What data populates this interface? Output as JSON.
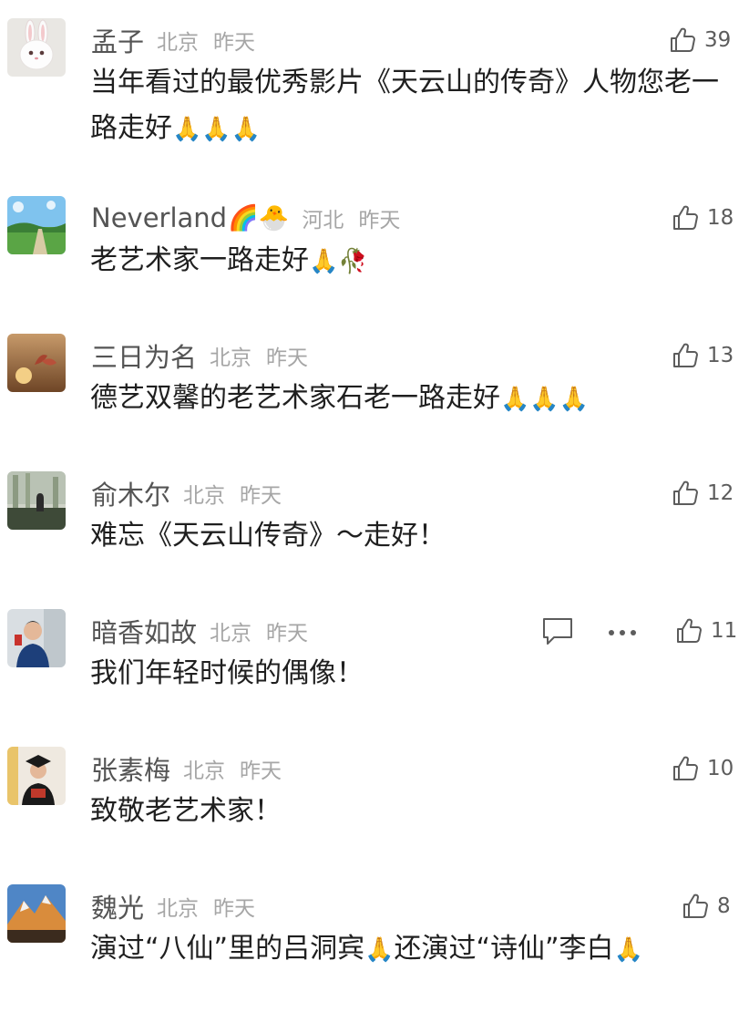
{
  "comments": [
    {
      "name": "孟子",
      "location": "北京",
      "time": "昨天",
      "likes": "39",
      "text": "当年看过的最优秀影片《天云山的传奇》人物您老一路走好",
      "emoji": "🙏🙏🙏"
    },
    {
      "name": "Neverland",
      "name_emoji": "🌈🐣",
      "location": "河北",
      "time": "昨天",
      "likes": "18",
      "text": "老艺术家一路走好",
      "emoji": "🙏🥀"
    },
    {
      "name": "三日为名",
      "location": "北京",
      "time": "昨天",
      "likes": "13",
      "text": "德艺双馨的老艺术家石老一路走好",
      "emoji": "🙏🙏🙏"
    },
    {
      "name": "俞木尔",
      "location": "北京",
      "time": "昨天",
      "likes": "12",
      "text": "难忘《天云山传奇》～走好！"
    },
    {
      "name": "暗香如故",
      "location": "北京",
      "time": "昨天",
      "likes": "11",
      "text": "我们年轻时候的偶像！"
    },
    {
      "name": "张素梅",
      "location": "北京",
      "time": "昨天",
      "likes": "10",
      "text": "致敬老艺术家！"
    },
    {
      "name": "魏光",
      "location": "北京",
      "time": "昨天",
      "likes": "8",
      "text_parts": [
        "演过“八仙”里的吕洞宾",
        "🙏",
        "还演过“诗仙”李白",
        "🙏"
      ]
    }
  ],
  "icons": {
    "like": "thumbs-up-icon",
    "reply": "comment-bubble-icon",
    "more": "more-dots-icon"
  }
}
